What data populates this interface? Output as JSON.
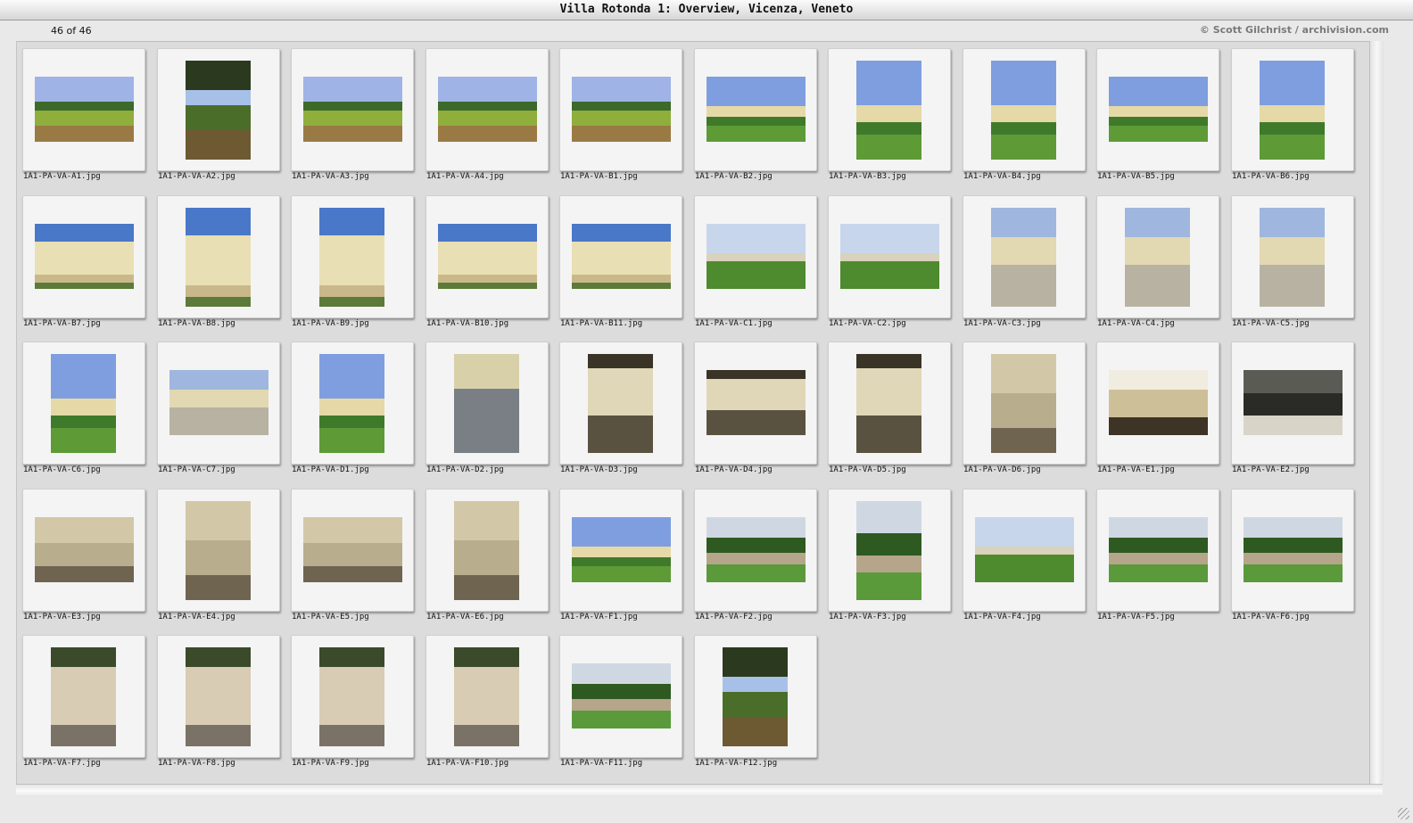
{
  "window": {
    "title": "Villa Rotonda 1: Overview, Vicenza, Veneto"
  },
  "status": {
    "count_text": "46 of 46",
    "credit": "© Scott Gilchrist / archivision.com"
  },
  "thumbnails": [
    {
      "name": "1A1-PA-VA-A1.jpg",
      "orientation": "landscape",
      "scene": "field"
    },
    {
      "name": "1A1-PA-VA-A2.jpg",
      "orientation": "portrait",
      "scene": "trees"
    },
    {
      "name": "1A1-PA-VA-A3.jpg",
      "orientation": "landscape",
      "scene": "field"
    },
    {
      "name": "1A1-PA-VA-A4.jpg",
      "orientation": "landscape",
      "scene": "field"
    },
    {
      "name": "1A1-PA-VA-B1.jpg",
      "orientation": "landscape",
      "scene": "field"
    },
    {
      "name": "1A1-PA-VA-B2.jpg",
      "orientation": "landscape",
      "scene": "villa"
    },
    {
      "name": "1A1-PA-VA-B3.jpg",
      "orientation": "portrait",
      "scene": "villa"
    },
    {
      "name": "1A1-PA-VA-B4.jpg",
      "orientation": "portrait",
      "scene": "villa"
    },
    {
      "name": "1A1-PA-VA-B5.jpg",
      "orientation": "landscape",
      "scene": "villa"
    },
    {
      "name": "1A1-PA-VA-B6.jpg",
      "orientation": "portrait",
      "scene": "villa"
    },
    {
      "name": "1A1-PA-VA-B7.jpg",
      "orientation": "landscape",
      "scene": "building"
    },
    {
      "name": "1A1-PA-VA-B8.jpg",
      "orientation": "portrait",
      "scene": "building"
    },
    {
      "name": "1A1-PA-VA-B9.jpg",
      "orientation": "portrait",
      "scene": "building"
    },
    {
      "name": "1A1-PA-VA-B10.jpg",
      "orientation": "landscape",
      "scene": "building"
    },
    {
      "name": "1A1-PA-VA-B11.jpg",
      "orientation": "landscape",
      "scene": "building"
    },
    {
      "name": "1A1-PA-VA-C1.jpg",
      "orientation": "landscape",
      "scene": "lawn"
    },
    {
      "name": "1A1-PA-VA-C2.jpg",
      "orientation": "landscape",
      "scene": "lawn"
    },
    {
      "name": "1A1-PA-VA-C3.jpg",
      "orientation": "portrait",
      "scene": "path"
    },
    {
      "name": "1A1-PA-VA-C4.jpg",
      "orientation": "portrait",
      "scene": "path"
    },
    {
      "name": "1A1-PA-VA-C5.jpg",
      "orientation": "portrait",
      "scene": "path"
    },
    {
      "name": "1A1-PA-VA-C6.jpg",
      "orientation": "portrait",
      "scene": "villa"
    },
    {
      "name": "1A1-PA-VA-C7.jpg",
      "orientation": "landscape",
      "scene": "path"
    },
    {
      "name": "1A1-PA-VA-D1.jpg",
      "orientation": "portrait",
      "scene": "villa"
    },
    {
      "name": "1A1-PA-VA-D2.jpg",
      "orientation": "portrait",
      "scene": "stairs"
    },
    {
      "name": "1A1-PA-VA-D3.jpg",
      "orientation": "portrait",
      "scene": "portico"
    },
    {
      "name": "1A1-PA-VA-D4.jpg",
      "orientation": "landscape",
      "scene": "portico"
    },
    {
      "name": "1A1-PA-VA-D5.jpg",
      "orientation": "portrait",
      "scene": "portico"
    },
    {
      "name": "1A1-PA-VA-D6.jpg",
      "orientation": "portrait",
      "scene": "wall"
    },
    {
      "name": "1A1-PA-VA-E1.jpg",
      "orientation": "landscape",
      "scene": "pediment"
    },
    {
      "name": "1A1-PA-VA-E2.jpg",
      "orientation": "landscape",
      "scene": "dark"
    },
    {
      "name": "1A1-PA-VA-E3.jpg",
      "orientation": "landscape",
      "scene": "wall"
    },
    {
      "name": "1A1-PA-VA-E4.jpg",
      "orientation": "portrait",
      "scene": "wall"
    },
    {
      "name": "1A1-PA-VA-E5.jpg",
      "orientation": "landscape",
      "scene": "wall"
    },
    {
      "name": "1A1-PA-VA-E6.jpg",
      "orientation": "portrait",
      "scene": "wall"
    },
    {
      "name": "1A1-PA-VA-F1.jpg",
      "orientation": "landscape",
      "scene": "villa"
    },
    {
      "name": "1A1-PA-VA-F2.jpg",
      "orientation": "landscape",
      "scene": "garden"
    },
    {
      "name": "1A1-PA-VA-F3.jpg",
      "orientation": "portrait",
      "scene": "garden"
    },
    {
      "name": "1A1-PA-VA-F4.jpg",
      "orientation": "landscape",
      "scene": "lawn"
    },
    {
      "name": "1A1-PA-VA-F5.jpg",
      "orientation": "landscape",
      "scene": "garden"
    },
    {
      "name": "1A1-PA-VA-F6.jpg",
      "orientation": "landscape",
      "scene": "garden"
    },
    {
      "name": "1A1-PA-VA-F7.jpg",
      "orientation": "portrait",
      "scene": "statue"
    },
    {
      "name": "1A1-PA-VA-F8.jpg",
      "orientation": "portrait",
      "scene": "statue"
    },
    {
      "name": "1A1-PA-VA-F9.jpg",
      "orientation": "portrait",
      "scene": "statue"
    },
    {
      "name": "1A1-PA-VA-F10.jpg",
      "orientation": "portrait",
      "scene": "statue"
    },
    {
      "name": "1A1-PA-VA-F11.jpg",
      "orientation": "landscape",
      "scene": "garden"
    },
    {
      "name": "1A1-PA-VA-F12.jpg",
      "orientation": "portrait",
      "scene": "trees"
    }
  ]
}
